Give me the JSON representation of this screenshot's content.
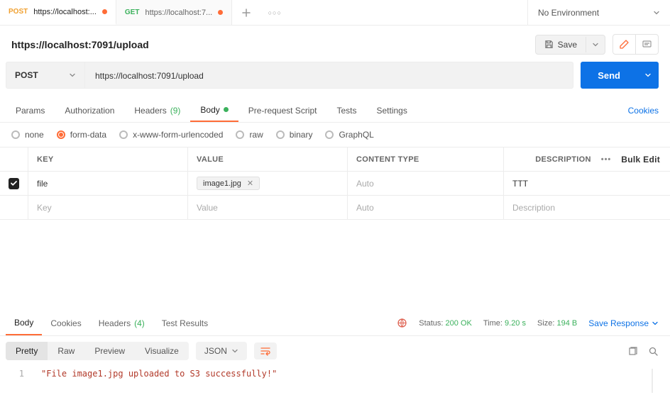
{
  "tabs": [
    {
      "method": "POST",
      "method_class": "method-post",
      "label": "https://localhost:..."
    },
    {
      "method": "GET",
      "method_class": "method-get",
      "label": "https://localhost:7..."
    }
  ],
  "environment": {
    "selected": "No Environment"
  },
  "request": {
    "title": "https://localhost:7091/upload",
    "method": "POST",
    "url": "https://localhost:7091/upload",
    "save_label": "Save",
    "send_label": "Send"
  },
  "req_tabs": {
    "params": "Params",
    "auth": "Authorization",
    "headers": "Headers",
    "headers_count": "(9)",
    "body": "Body",
    "prereq": "Pre-request Script",
    "tests": "Tests",
    "settings": "Settings",
    "cookies": "Cookies"
  },
  "body_types": {
    "none": "none",
    "formdata": "form-data",
    "urlencoded": "x-www-form-urlencoded",
    "raw": "raw",
    "binary": "binary",
    "graphql": "GraphQL"
  },
  "kv": {
    "headers": {
      "key": "KEY",
      "value": "VALUE",
      "content_type": "CONTENT TYPE",
      "description": "DESCRIPTION",
      "bulk": "Bulk Edit"
    },
    "rows": [
      {
        "checked": true,
        "key": "file",
        "file": "image1.jpg",
        "content_type": "Auto",
        "desc": "TTT"
      }
    ],
    "placeholders": {
      "key": "Key",
      "value": "Value",
      "content_type": "Auto",
      "desc": "Description"
    }
  },
  "response": {
    "tabs": {
      "body": "Body",
      "cookies": "Cookies",
      "headers": "Headers",
      "headers_count": "(4)",
      "tests": "Test Results"
    },
    "status_label": "Status:",
    "status_value": "200 OK",
    "time_label": "Time:",
    "time_value": "9.20 s",
    "size_label": "Size:",
    "size_value": "194 B",
    "save_response": "Save Response"
  },
  "view": {
    "pretty": "Pretty",
    "raw": "Raw",
    "preview": "Preview",
    "visualize": "Visualize",
    "format": "JSON"
  },
  "body_content": {
    "line_no": "1",
    "text": "\"File image1.jpg uploaded to S3 successfully!\""
  }
}
